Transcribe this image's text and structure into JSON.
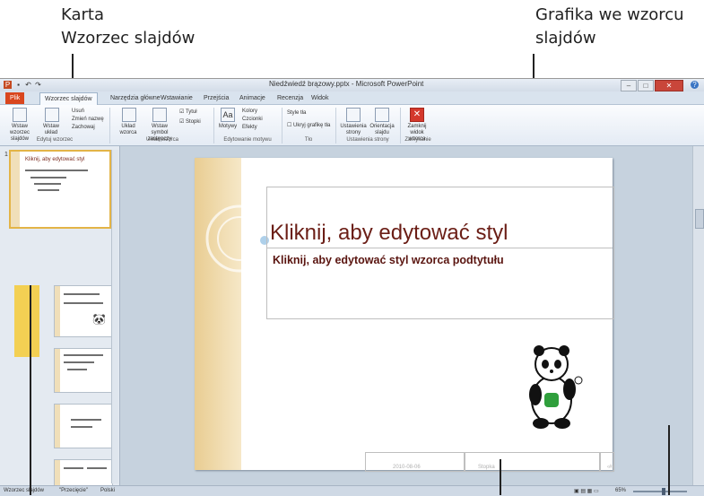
{
  "callouts": {
    "tab_callout_line1": "Karta",
    "tab_callout_line2": "Wzorzec slajdów",
    "graphic_callout_line1": "Grafika we wzorcu",
    "graphic_callout_line2": "slajdów"
  },
  "window": {
    "title": "Niedźwiedź brązowy.pptx - Microsoft PowerPoint"
  },
  "tabs": [
    {
      "label": "Plik"
    },
    {
      "label": "Wzorzec slajdów"
    },
    {
      "label": "Narzędzia główne"
    },
    {
      "label": "Wstawianie"
    },
    {
      "label": "Przejścia"
    },
    {
      "label": "Animacje"
    },
    {
      "label": "Recenzja"
    },
    {
      "label": "Widok"
    }
  ],
  "ribbon": {
    "insert_master_label": "Wstaw wzorzec slajdów",
    "insert_layout_label": "Wstaw układ",
    "delete_label": "Usuń",
    "rename_label": "Zmień nazwę",
    "preserve_label": "Zachowaj",
    "group_edit_master": "Edytuj wzorzec",
    "master_layout_label": "Układ wzorca",
    "insert_placeholder_label": "Wstaw symbol zastępczy",
    "title_checkbox_label": "Tytuł",
    "footers_checkbox_label": "Stopki",
    "group_master_layout": "Układ wzorca",
    "themes_label": "Motywy",
    "colors_label": "Kolory",
    "fonts_label": "Czcionki",
    "effects_label": "Efekty",
    "group_edit_theme": "Edytowanie motywu",
    "bg_styles_label": "Style tła",
    "hide_bg_label": "Ukryj grafikę tła",
    "group_background": "Tło",
    "page_setup_label": "Ustawienia strony",
    "orientation_label": "Orientacja slajdu",
    "group_page_setup": "Ustawienia strony",
    "close_master_label": "Zamknij widok wzorca",
    "group_close": "Zamykanie"
  },
  "thumbnails": [
    {
      "num": "1",
      "title": "Kliknij, aby edytować styl"
    },
    {
      "num": "",
      "title": "Kliknij, aby edytować styl"
    },
    {
      "num": "",
      "title": "Kliknij, aby edytować styl"
    },
    {
      "num": "",
      "title": "Kliknij, aby edytować styl"
    },
    {
      "num": "",
      "title": "Kliknij, aby edytować styl"
    },
    {
      "num": "",
      "title": "Kliknij, aby edytować styl"
    }
  ],
  "slide": {
    "title": "Kliknij, aby edytować styl",
    "subtitle": "Kliknij, aby edytować styl wzorca podtytułu",
    "footer_date": "2010-08-06",
    "footer_text": "Stopka",
    "footer_num": "‹#›"
  },
  "statusbar": {
    "view_name": "Wzorzec slajdów",
    "theme_name": "\"Przecięcie\"",
    "language": "Polski",
    "zoom": "65%"
  }
}
